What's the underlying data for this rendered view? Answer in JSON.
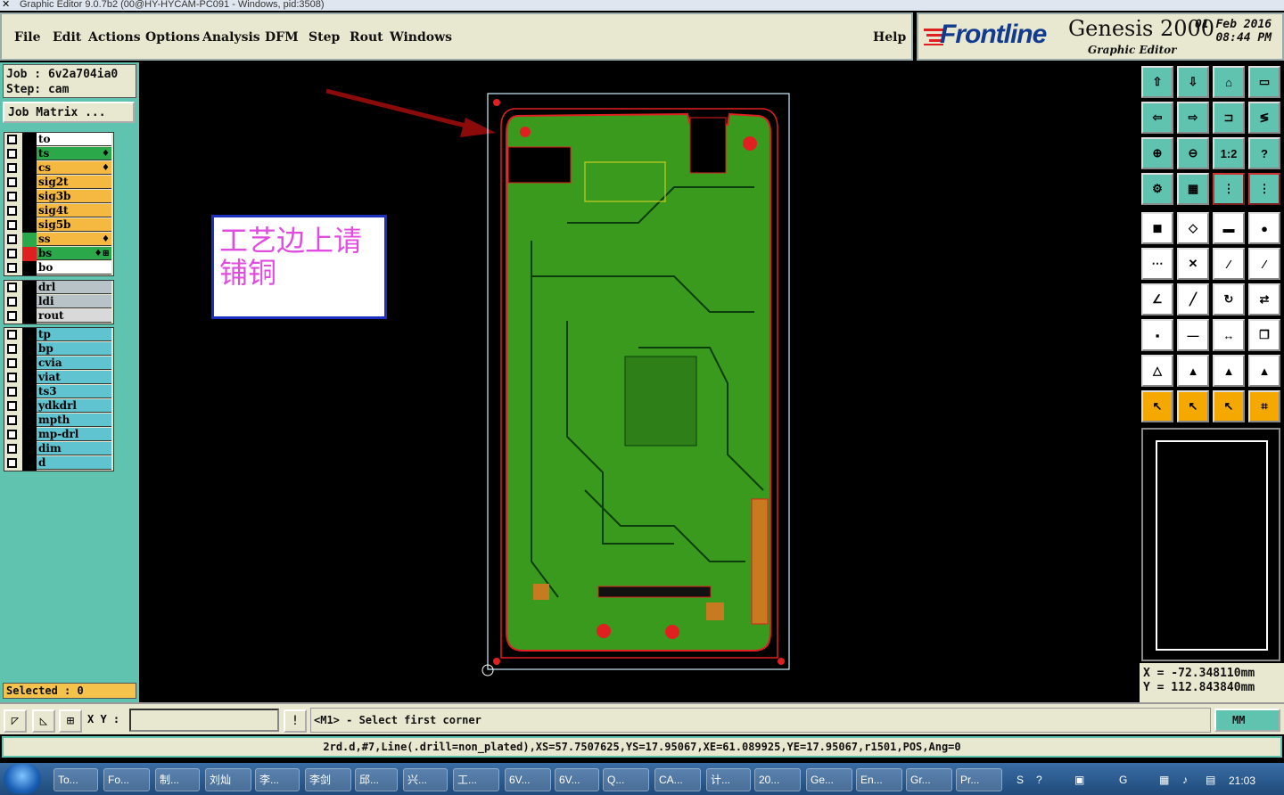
{
  "window": {
    "title": "Graphic Editor 9.0.7b2 (00@HY-HYCAM-PC091 - Windows, pid:3508)"
  },
  "menu": {
    "file": "File",
    "edit": "Edit",
    "actions": "Actions",
    "options": "Options",
    "analysis": "Analysis",
    "dfm": "DFM",
    "step": "Step",
    "rout": "Rout",
    "windows": "Windows",
    "help": "Help"
  },
  "logo": {
    "brand": "Frontline",
    "product": "Genesis 2000",
    "subtitle": "Graphic Editor",
    "date_line1": "01 Feb 2016",
    "date_line2": "08:44 PM"
  },
  "job": {
    "job_line": "Job : 6v2a704ia0",
    "step_line": "Step: cam",
    "matrix_button": "Job Matrix ..."
  },
  "layers_board": [
    {
      "name": "to",
      "color": "#ffffff",
      "swatch": "#000000",
      "flag": ""
    },
    {
      "name": "ts",
      "color": "#2aa84a",
      "swatch": "#000000",
      "flag": "♦"
    },
    {
      "name": "cs",
      "color": "#f5b942",
      "swatch": "#000000",
      "flag": "♦"
    },
    {
      "name": "sig2t",
      "color": "#f5b942",
      "swatch": "#000000",
      "flag": ""
    },
    {
      "name": "sig3b",
      "color": "#f5b942",
      "swatch": "#000000",
      "flag": ""
    },
    {
      "name": "sig4t",
      "color": "#f5b942",
      "swatch": "#000000",
      "flag": ""
    },
    {
      "name": "sig5b",
      "color": "#f5b942",
      "swatch": "#000000",
      "flag": ""
    },
    {
      "name": "ss",
      "color": "#f5b942",
      "swatch": "#2aa84a",
      "flag": "♦"
    },
    {
      "name": "bs",
      "color": "#2aa84a",
      "swatch": "#e02020",
      "flag": "♦⊞"
    },
    {
      "name": "bo",
      "color": "#ffffff",
      "swatch": "#000000",
      "flag": ""
    }
  ],
  "layers_drill": [
    {
      "name": "drl",
      "color": "#b7c3c7",
      "swatch": "#000000"
    },
    {
      "name": "ldi",
      "color": "#b7c3c7",
      "swatch": "#000000"
    },
    {
      "name": "rout",
      "color": "#d9d9d9",
      "swatch": "#000000"
    }
  ],
  "layers_misc": [
    {
      "name": "tp",
      "color": "#5fc3d0",
      "swatch": "#000000"
    },
    {
      "name": "bp",
      "color": "#5fc3d0",
      "swatch": "#000000"
    },
    {
      "name": "cvia",
      "color": "#5fc3d0",
      "swatch": "#000000"
    },
    {
      "name": "viat",
      "color": "#5fc3d0",
      "swatch": "#000000"
    },
    {
      "name": "ts3",
      "color": "#5fc3d0",
      "swatch": "#000000"
    },
    {
      "name": "ydkdrl",
      "color": "#5fc3d0",
      "swatch": "#000000"
    },
    {
      "name": "mpth",
      "color": "#5fc3d0",
      "swatch": "#000000"
    },
    {
      "name": "mp-drl",
      "color": "#5fc3d0",
      "swatch": "#000000"
    },
    {
      "name": "dim",
      "color": "#5fc3d0",
      "swatch": "#000000"
    },
    {
      "name": "d",
      "color": "#5fc3d0",
      "swatch": "#000000"
    }
  ],
  "selected_text": "Selected : 0",
  "annotation": {
    "text": "工艺边上请铺铜"
  },
  "toolbar_labels": {
    "ratio": "1:2",
    "help": "?"
  },
  "coords": {
    "x_line": "X = -72.348110mm",
    "y_line": "Y = 112.843840mm"
  },
  "command": {
    "xy_label": "X Y :",
    "xy_value": "",
    "prompt": "<M1> - Select first corner",
    "units": "MM"
  },
  "status": "2rd.d,#7,Line(.drill=non_plated),XS=57.7507625,YS=17.95067,XE=61.089925,YE=17.95067,r1501,POS,Ang=0",
  "taskbar": {
    "tasks": [
      "To...",
      "Fo...",
      "制...",
      "刘灿",
      "李...",
      "李剑",
      "邱...",
      "兴...",
      "工...",
      "6V...",
      "6V...",
      "Q...",
      "CA...",
      "计...",
      "20...",
      "Ge...",
      "En...",
      "Gr...",
      "Pr..."
    ],
    "clock": "21:03"
  },
  "colors": {
    "panel_teal": "#5fc3b0",
    "panel_cream": "#e8e8d0",
    "copper_green": "#3a9a1e",
    "outline_red": "#e02020"
  }
}
